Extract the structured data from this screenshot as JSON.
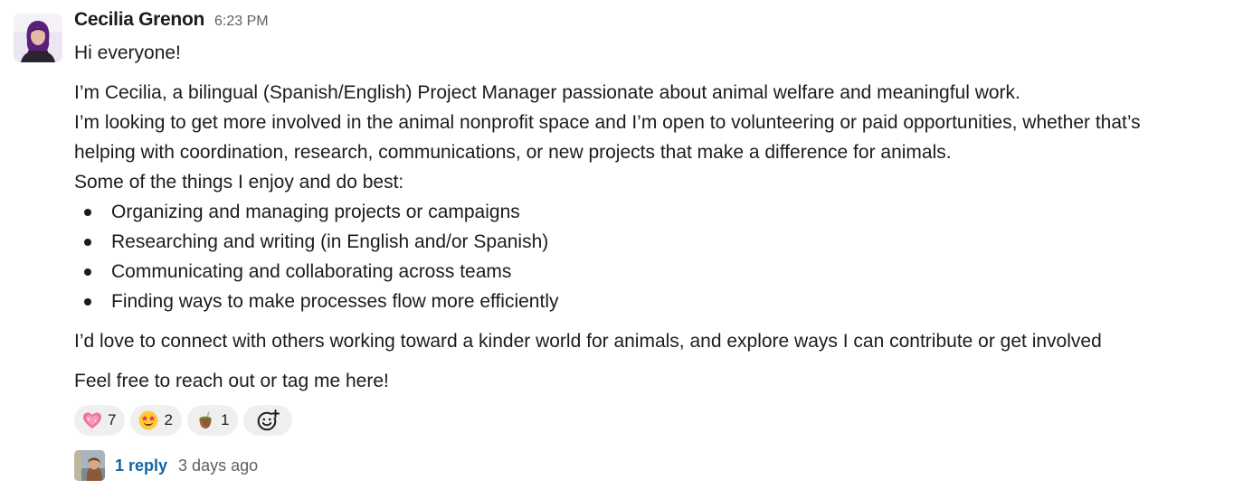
{
  "message": {
    "sender": "Cecilia Grenon",
    "time": "6:23 PM",
    "greeting": "Hi everyone!",
    "intro_lines": [
      "I’m Cecilia, a bilingual (Spanish/English) Project Manager passionate about animal welfare and meaningful work.",
      "I’m looking to get more involved in the animal nonprofit space and I’m open to volunteering or paid opportunities, whether that’s",
      "helping with coordination, research, communications, or new projects that make a difference for animals.",
      "Some of the things I enjoy and do best:"
    ],
    "skills": [
      "Organizing and managing projects or campaigns",
      "Researching and writing (in English and/or Spanish)",
      "Communicating and collaborating across teams",
      "Finding ways to make processes flow more efficiently"
    ],
    "closing": "I’d love to connect with others working toward a kinder world for animals, and explore ways I can contribute or get involved",
    "signoff": "Feel free to reach out or tag me here!"
  },
  "reactions": [
    {
      "emoji": "sparkling-heart-emoji",
      "count": "7"
    },
    {
      "emoji": "star-struck-emoji",
      "count": "2"
    },
    {
      "emoji": "mate-drink-emoji",
      "count": "1"
    }
  ],
  "add_reaction_icon": "add-reaction-icon",
  "thread": {
    "replies": "1 reply",
    "last_reply": "3 days ago"
  },
  "colors": {
    "text": "#1d1c1d",
    "muted": "#616061",
    "link": "#1264a3",
    "reaction_bg": "#f0eff0"
  }
}
